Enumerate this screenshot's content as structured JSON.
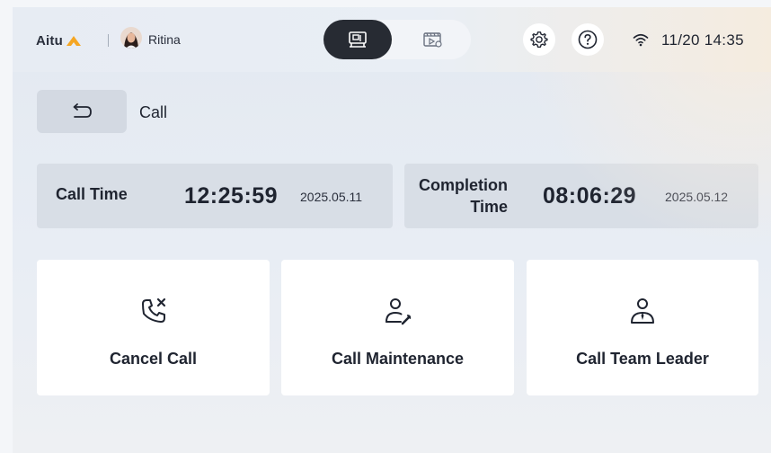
{
  "header": {
    "brand": "Aitu",
    "user_name": "Ritina",
    "datetime": "11/20 14:35",
    "icons": {
      "brand_mark": "aitu-logo-icon",
      "mode_active": "machine-icon",
      "mode_inactive": "video-monitor-icon",
      "settings": "gear-icon",
      "help": "help-icon",
      "wifi": "wifi-icon"
    }
  },
  "page": {
    "title": "Call",
    "back_icon": "back-arrow-icon"
  },
  "times": {
    "call": {
      "label": "Call Time",
      "time": "12:25:59",
      "date": "2025.05.11"
    },
    "completion": {
      "label_line1": "Completion",
      "label_line2": "Time",
      "time": "08:06:29",
      "date": "2025.05.12"
    }
  },
  "actions": [
    {
      "label": "Cancel Call",
      "icon": "phone-cancel-icon"
    },
    {
      "label": "Call Maintenance",
      "icon": "maintenance-person-icon"
    },
    {
      "label": "Call Team Leader",
      "icon": "team-leader-icon"
    }
  ],
  "colors": {
    "brand_accent": "#f5a623",
    "dark_button": "#272b33",
    "text_primary": "#1f2430"
  }
}
